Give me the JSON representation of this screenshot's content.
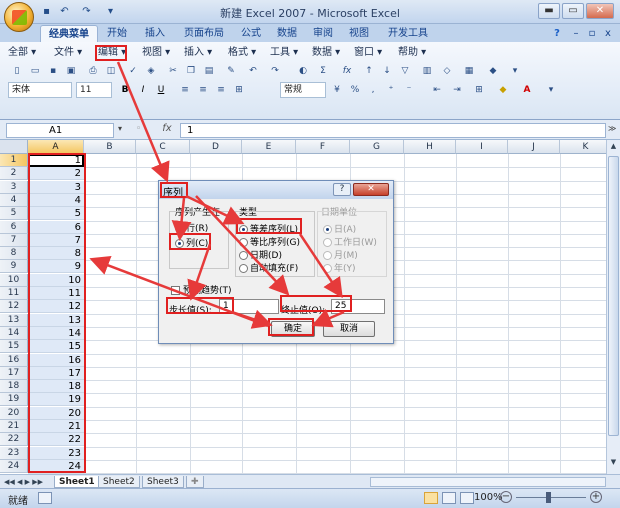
{
  "window": {
    "title": "新建 Excel 2007 - Microsoft Excel",
    "min": "▬",
    "max": "▭",
    "close": "✕"
  },
  "qat": {
    "save": "▪",
    "undo": "↶",
    "redo": "↷",
    "more": "▾"
  },
  "tabs": [
    "经典菜单",
    "开始",
    "插入",
    "页面布局",
    "公式",
    "数据",
    "审阅",
    "视图",
    "开发工具"
  ],
  "help": {
    "q": "?",
    "min": "–",
    "restore": "▫",
    "close": "x"
  },
  "menus": [
    "全部 ▾",
    "文件 ▾",
    "编辑 ▾",
    "视图 ▾",
    "插入 ▾",
    "格式 ▾",
    "工具 ▾",
    "数据 ▾",
    "窗口 ▾",
    "帮助 ▾"
  ],
  "toolbar": {
    "font": "宋体",
    "size": "11",
    "bold": "B",
    "italic": "I",
    "underline": "U",
    "number_format": "常规",
    "percent": "%",
    "comma": ",",
    "sigma": "Σ",
    "fx": "fx"
  },
  "formula_bar": {
    "name_box": "A1",
    "fx": "fx",
    "content": "1"
  },
  "columns": [
    "A",
    "B",
    "C",
    "D",
    "E",
    "F",
    "G",
    "H",
    "I",
    "J",
    "K"
  ],
  "rows": [
    "1",
    "2",
    "3",
    "4",
    "5",
    "6",
    "7",
    "8",
    "9",
    "10",
    "11",
    "12",
    "13",
    "14",
    "15",
    "16",
    "17",
    "18",
    "19",
    "20",
    "21",
    "22",
    "23",
    "24"
  ],
  "col_a_values": [
    "1",
    "2",
    "3",
    "4",
    "5",
    "6",
    "7",
    "8",
    "9",
    "10",
    "11",
    "12",
    "13",
    "14",
    "15",
    "16",
    "17",
    "18",
    "19",
    "20",
    "21",
    "22",
    "23",
    "24"
  ],
  "sheets": [
    "Sheet1",
    "Sheet2",
    "Sheet3"
  ],
  "status": {
    "ready": "就绪",
    "zoom": "100%",
    "minus": "−",
    "plus": "+"
  },
  "dialog": {
    "title": "序列",
    "help": "?",
    "close": "✕",
    "group_series_in": "序列产生在",
    "row": "行(R)",
    "col": "列(C)",
    "group_type": "类型",
    "linear": "等差序列(L)",
    "growth": "等比序列(G)",
    "date": "日期(D)",
    "autofill": "自动填充(F)",
    "group_date_unit": "日期单位",
    "day": "日(A)",
    "weekday": "工作日(W)",
    "month": "月(M)",
    "year": "年(Y)",
    "trend": "预测趋势(T)",
    "step_label": "步长值(S):",
    "step_value": "1",
    "stop_label": "终止值(O):",
    "stop_value": "25",
    "ok": "确定",
    "cancel": "取消"
  }
}
